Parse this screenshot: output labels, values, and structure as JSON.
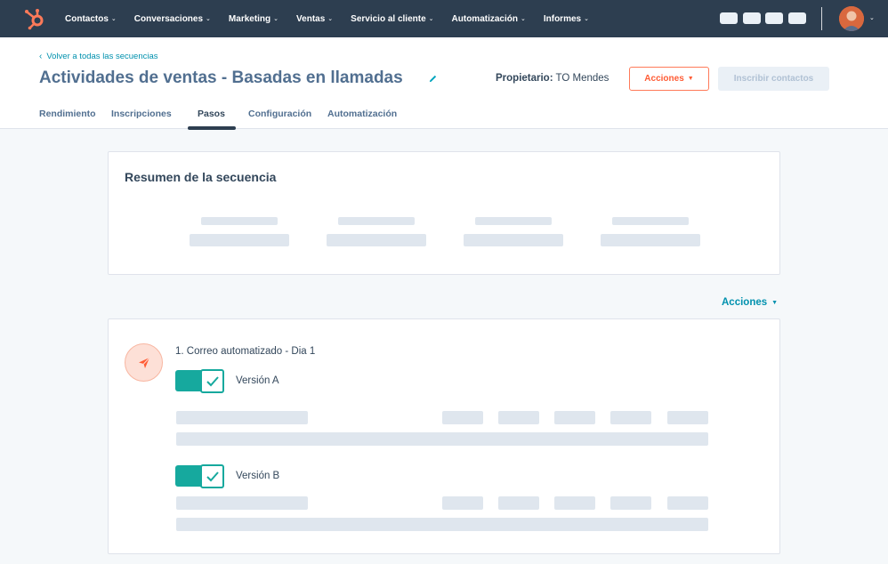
{
  "nav": {
    "items": [
      "Contactos",
      "Conversaciones",
      "Marketing",
      "Ventas",
      "Servicio al cliente",
      "Automatización",
      "Informes"
    ],
    "caret_icon": "chevron-down-icon",
    "colors": {
      "bar": "#2d3e50",
      "logo": "#ff7a59"
    }
  },
  "header": {
    "back_link": "Volver a todas las secuencias",
    "title": "Actividades de ventas - Basadas en llamadas",
    "owner_label": "Propietario:",
    "owner_name": "TO Mendes",
    "actions_button": "Acciones",
    "enroll_button": "Inscribir contactos"
  },
  "tabs": [
    {
      "label": "Rendimiento",
      "active": false
    },
    {
      "label": "Inscripciones",
      "active": false
    },
    {
      "label": "Pasos",
      "active": true
    },
    {
      "label": "Configuración",
      "active": false
    },
    {
      "label": "Automatización",
      "active": false
    }
  ],
  "summary": {
    "title": "Resumen de la secuencia"
  },
  "actions_link": "Acciones",
  "step": {
    "title": "1. Correo automatizado - Dia 1",
    "icon": "paper-plane-icon",
    "versions": [
      {
        "label": "Versión A",
        "enabled": true
      },
      {
        "label": "Versión B",
        "enabled": true
      }
    ]
  },
  "colors": {
    "accent_orange": "#ff7a59",
    "teal": "#16a99e",
    "link": "#0091ae"
  }
}
